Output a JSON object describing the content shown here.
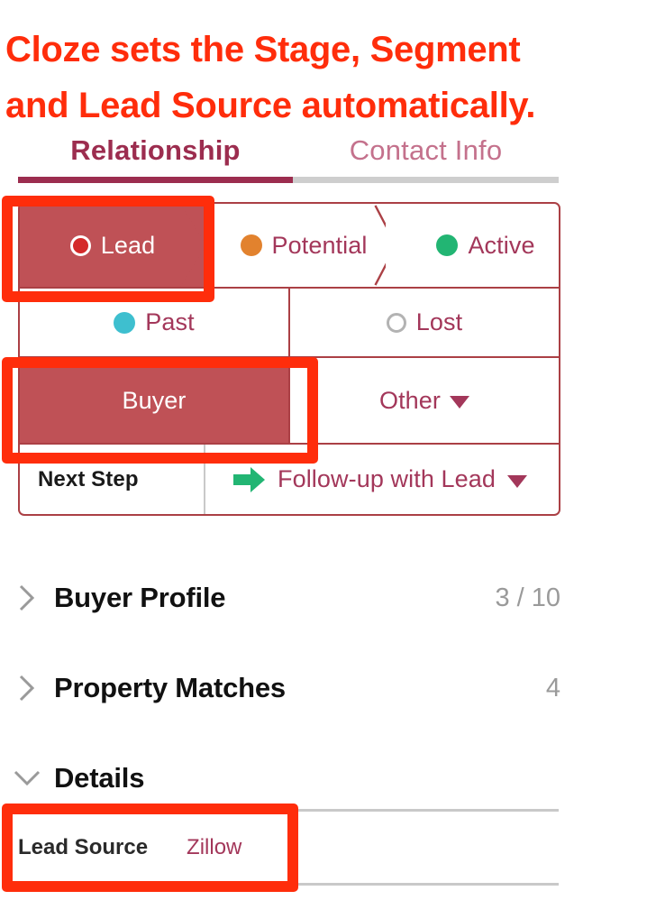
{
  "annotation": {
    "headline_line1": "Cloze sets the Stage, Segment",
    "headline_line2": "and Lead Source automatically.",
    "color": "#FF2D0B"
  },
  "tabs": [
    {
      "label": "Relationship",
      "active": true
    },
    {
      "label": "Contact Info",
      "active": false
    }
  ],
  "stage_selector": {
    "options": [
      {
        "label": "Lead",
        "dot": "red-ring-dot",
        "dot_color": "#D42A2A",
        "selected": true
      },
      {
        "label": "Potential",
        "dot": "orange-dot",
        "dot_color": "#E2822E",
        "selected": false
      },
      {
        "label": "Active",
        "dot": "green-dot",
        "dot_color": "#22B573",
        "selected": false
      },
      {
        "label": "Past",
        "dot": "teal-dot",
        "dot_color": "#3EBFCF",
        "selected": false
      },
      {
        "label": "Lost",
        "dot": "hollow-gray-dot",
        "dot_color": "#B3B3B3",
        "selected": false
      }
    ]
  },
  "segment_selector": {
    "selected_label": "Buyer",
    "other_label": "Other",
    "other_caret": "chevron-down-icon"
  },
  "next_step": {
    "label": "Next Step",
    "value": "Follow-up with Lead",
    "icon": "green-arrow-right-icon",
    "icon_color": "#22B573",
    "caret": "chevron-down-icon"
  },
  "sections": [
    {
      "title": "Buyer Profile",
      "count": "3 / 10",
      "expanded": false,
      "chevron": "chevron-right-icon"
    },
    {
      "title": "Property Matches",
      "count": "4",
      "expanded": false,
      "chevron": "chevron-right-icon"
    },
    {
      "title": "Details",
      "count": "",
      "expanded": true,
      "chevron": "chevron-down-icon"
    }
  ],
  "details": {
    "fields": [
      {
        "label": "Lead Source",
        "value": "Zillow"
      }
    ]
  },
  "theme": {
    "accent_maroon": "#A3375A",
    "selected_fill": "#BF5156",
    "border_brick": "#AB4045",
    "tab_active": "#9C2D4F",
    "tab_inactive": "#C4718C",
    "muted_gray": "#9A9A9A"
  }
}
